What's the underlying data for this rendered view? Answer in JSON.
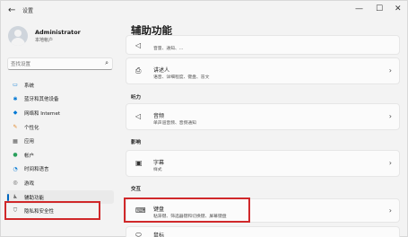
{
  "window": {
    "back_icon": "back-arrow-icon",
    "title": "设置",
    "controls": [
      "minimize-icon",
      "maximize-icon",
      "close-icon"
    ]
  },
  "profile": {
    "name": "Administrator",
    "subtitle": "本地帐户"
  },
  "search": {
    "placeholder": "查找设置",
    "icon": "search-icon"
  },
  "nav": {
    "items": [
      {
        "label": "系统",
        "icon": "monitor-icon",
        "color": "#0078d4"
      },
      {
        "label": "蓝牙和其他设备",
        "icon": "bluetooth-icon",
        "color": "#0078d4"
      },
      {
        "label": "网络和 Internet",
        "icon": "wifi-icon",
        "color": "#0078d4"
      },
      {
        "label": "个性化",
        "icon": "brush-icon",
        "color": "#e08a2c"
      },
      {
        "label": "应用",
        "icon": "apps-icon",
        "color": "#555555"
      },
      {
        "label": "帐户",
        "icon": "person-icon",
        "color": "#2aa05c"
      },
      {
        "label": "时间和语言",
        "icon": "globe-clock-icon",
        "color": "#0078d4"
      },
      {
        "label": "游戏",
        "icon": "gamepad-icon",
        "color": "#555555"
      },
      {
        "label": "辅助功能",
        "icon": "accessibility-icon",
        "color": "#1b1b1b"
      },
      {
        "label": "隐私和安全性",
        "icon": "shield-icon",
        "color": "#555555"
      }
    ],
    "active_index": 8
  },
  "main": {
    "title": "辅助功能",
    "top_card": {
      "subtitle": "音量、通知、..."
    },
    "narrator_card": {
      "title": "讲述人",
      "subtitle": "语音、详细程度、键盘、盲文"
    },
    "section_audio": "听力",
    "audio_card": {
      "title": "音频",
      "subtitle": "单声道音频、音频通知"
    },
    "section_captions": "影响",
    "captions_card": {
      "title": "字幕",
      "subtitle": "样式"
    },
    "section_interaction": "交互",
    "keyboard_card": {
      "title": "键盘",
      "subtitle": "粘滞键、筛选器键和切换键、屏幕键盘"
    },
    "mouse_card": {
      "title": "鼠标"
    }
  }
}
